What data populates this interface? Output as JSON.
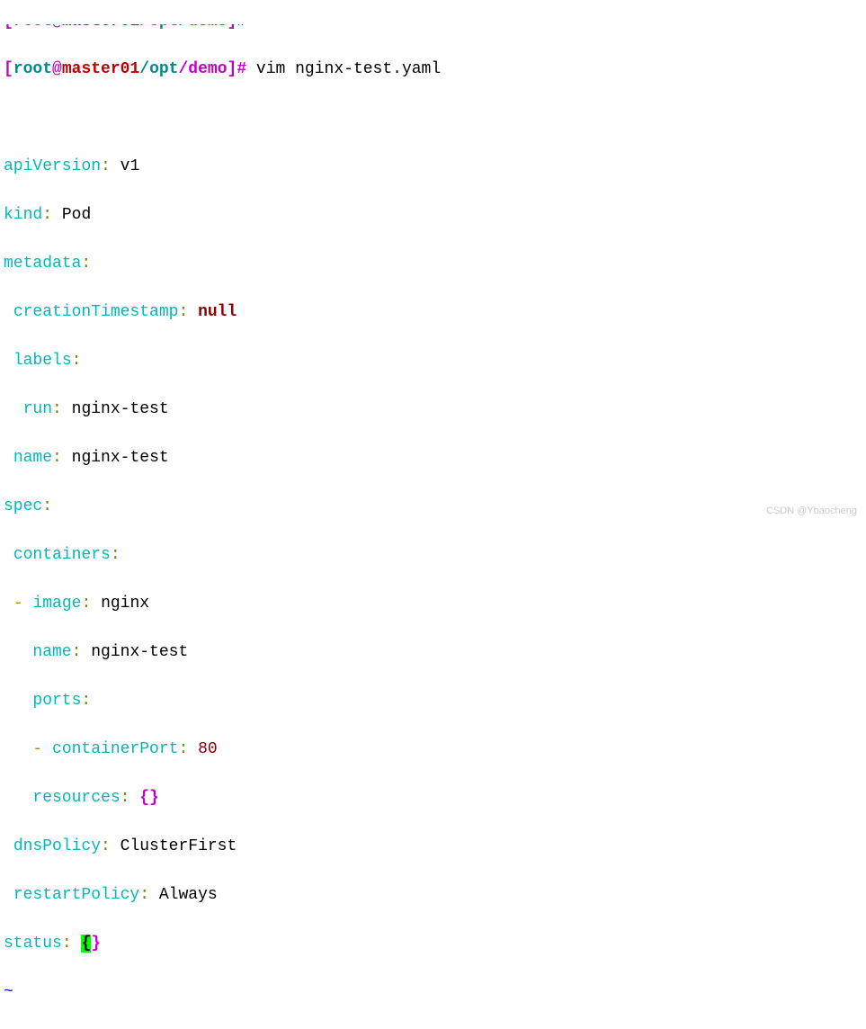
{
  "prompt": {
    "user": "root",
    "at": "@",
    "host": "master01",
    "path_opt": "/opt",
    "path_demo": "/demo",
    "open": "[",
    "close": "]",
    "hash": "#",
    "command": " vim nginx-test.yaml"
  },
  "yaml": {
    "apiVersion_key": "apiVersion",
    "apiVersion_val": "v1",
    "kind_key": "kind",
    "kind_val": "Pod",
    "metadata_key": "metadata",
    "creationTimestamp_key": "creationTimestamp",
    "creationTimestamp_val": "null",
    "labels_key": "labels",
    "run_key": "run",
    "run_val": "nginx-test",
    "meta_name_key": "name",
    "meta_name_val": "nginx-test",
    "spec_key": "spec",
    "containers_key": "containers",
    "image_key": "image",
    "image_val": "nginx",
    "cont_name_key": "name",
    "cont_name_val": "nginx-test",
    "ports_key": "ports",
    "containerPort_key": "containerPort",
    "containerPort_val": "80",
    "resources_key": "resources",
    "resources_val": "{}",
    "dnsPolicy_key": "dnsPolicy",
    "dnsPolicy_val": "ClusterFirst",
    "restartPolicy_key": "restartPolicy",
    "restartPolicy_val": "Always",
    "status_key": "status",
    "status_open": "{",
    "status_close": "}",
    "colon": ":",
    "dash": "-",
    "space": " ",
    "tilde": "~"
  },
  "watermark": "CSDN @Ybaocheng"
}
